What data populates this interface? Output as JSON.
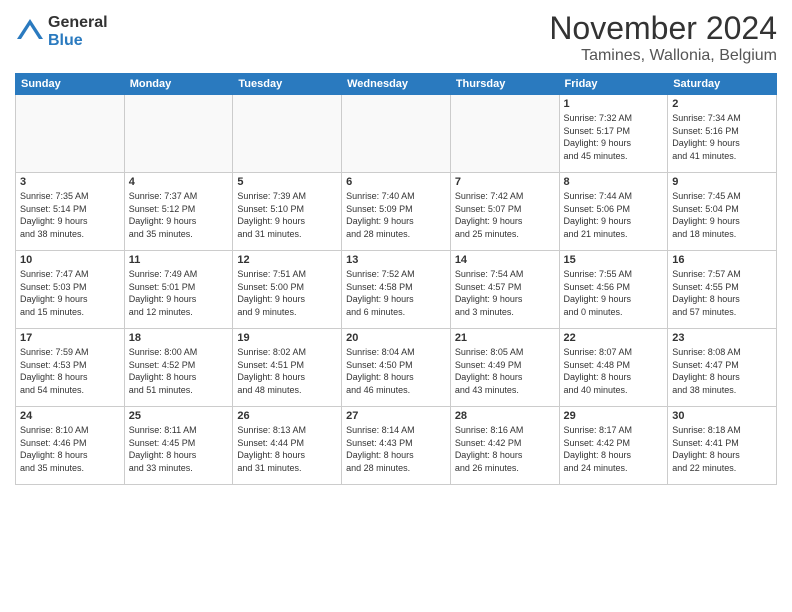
{
  "logo": {
    "general": "General",
    "blue": "Blue"
  },
  "title": "November 2024",
  "subtitle": "Tamines, Wallonia, Belgium",
  "headers": [
    "Sunday",
    "Monday",
    "Tuesday",
    "Wednesday",
    "Thursday",
    "Friday",
    "Saturday"
  ],
  "weeks": [
    [
      {
        "day": "",
        "info": ""
      },
      {
        "day": "",
        "info": ""
      },
      {
        "day": "",
        "info": ""
      },
      {
        "day": "",
        "info": ""
      },
      {
        "day": "",
        "info": ""
      },
      {
        "day": "1",
        "info": "Sunrise: 7:32 AM\nSunset: 5:17 PM\nDaylight: 9 hours\nand 45 minutes."
      },
      {
        "day": "2",
        "info": "Sunrise: 7:34 AM\nSunset: 5:16 PM\nDaylight: 9 hours\nand 41 minutes."
      }
    ],
    [
      {
        "day": "3",
        "info": "Sunrise: 7:35 AM\nSunset: 5:14 PM\nDaylight: 9 hours\nand 38 minutes."
      },
      {
        "day": "4",
        "info": "Sunrise: 7:37 AM\nSunset: 5:12 PM\nDaylight: 9 hours\nand 35 minutes."
      },
      {
        "day": "5",
        "info": "Sunrise: 7:39 AM\nSunset: 5:10 PM\nDaylight: 9 hours\nand 31 minutes."
      },
      {
        "day": "6",
        "info": "Sunrise: 7:40 AM\nSunset: 5:09 PM\nDaylight: 9 hours\nand 28 minutes."
      },
      {
        "day": "7",
        "info": "Sunrise: 7:42 AM\nSunset: 5:07 PM\nDaylight: 9 hours\nand 25 minutes."
      },
      {
        "day": "8",
        "info": "Sunrise: 7:44 AM\nSunset: 5:06 PM\nDaylight: 9 hours\nand 21 minutes."
      },
      {
        "day": "9",
        "info": "Sunrise: 7:45 AM\nSunset: 5:04 PM\nDaylight: 9 hours\nand 18 minutes."
      }
    ],
    [
      {
        "day": "10",
        "info": "Sunrise: 7:47 AM\nSunset: 5:03 PM\nDaylight: 9 hours\nand 15 minutes."
      },
      {
        "day": "11",
        "info": "Sunrise: 7:49 AM\nSunset: 5:01 PM\nDaylight: 9 hours\nand 12 minutes."
      },
      {
        "day": "12",
        "info": "Sunrise: 7:51 AM\nSunset: 5:00 PM\nDaylight: 9 hours\nand 9 minutes."
      },
      {
        "day": "13",
        "info": "Sunrise: 7:52 AM\nSunset: 4:58 PM\nDaylight: 9 hours\nand 6 minutes."
      },
      {
        "day": "14",
        "info": "Sunrise: 7:54 AM\nSunset: 4:57 PM\nDaylight: 9 hours\nand 3 minutes."
      },
      {
        "day": "15",
        "info": "Sunrise: 7:55 AM\nSunset: 4:56 PM\nDaylight: 9 hours\nand 0 minutes."
      },
      {
        "day": "16",
        "info": "Sunrise: 7:57 AM\nSunset: 4:55 PM\nDaylight: 8 hours\nand 57 minutes."
      }
    ],
    [
      {
        "day": "17",
        "info": "Sunrise: 7:59 AM\nSunset: 4:53 PM\nDaylight: 8 hours\nand 54 minutes."
      },
      {
        "day": "18",
        "info": "Sunrise: 8:00 AM\nSunset: 4:52 PM\nDaylight: 8 hours\nand 51 minutes."
      },
      {
        "day": "19",
        "info": "Sunrise: 8:02 AM\nSunset: 4:51 PM\nDaylight: 8 hours\nand 48 minutes."
      },
      {
        "day": "20",
        "info": "Sunrise: 8:04 AM\nSunset: 4:50 PM\nDaylight: 8 hours\nand 46 minutes."
      },
      {
        "day": "21",
        "info": "Sunrise: 8:05 AM\nSunset: 4:49 PM\nDaylight: 8 hours\nand 43 minutes."
      },
      {
        "day": "22",
        "info": "Sunrise: 8:07 AM\nSunset: 4:48 PM\nDaylight: 8 hours\nand 40 minutes."
      },
      {
        "day": "23",
        "info": "Sunrise: 8:08 AM\nSunset: 4:47 PM\nDaylight: 8 hours\nand 38 minutes."
      }
    ],
    [
      {
        "day": "24",
        "info": "Sunrise: 8:10 AM\nSunset: 4:46 PM\nDaylight: 8 hours\nand 35 minutes."
      },
      {
        "day": "25",
        "info": "Sunrise: 8:11 AM\nSunset: 4:45 PM\nDaylight: 8 hours\nand 33 minutes."
      },
      {
        "day": "26",
        "info": "Sunrise: 8:13 AM\nSunset: 4:44 PM\nDaylight: 8 hours\nand 31 minutes."
      },
      {
        "day": "27",
        "info": "Sunrise: 8:14 AM\nSunset: 4:43 PM\nDaylight: 8 hours\nand 28 minutes."
      },
      {
        "day": "28",
        "info": "Sunrise: 8:16 AM\nSunset: 4:42 PM\nDaylight: 8 hours\nand 26 minutes."
      },
      {
        "day": "29",
        "info": "Sunrise: 8:17 AM\nSunset: 4:42 PM\nDaylight: 8 hours\nand 24 minutes."
      },
      {
        "day": "30",
        "info": "Sunrise: 8:18 AM\nSunset: 4:41 PM\nDaylight: 8 hours\nand 22 minutes."
      }
    ]
  ]
}
